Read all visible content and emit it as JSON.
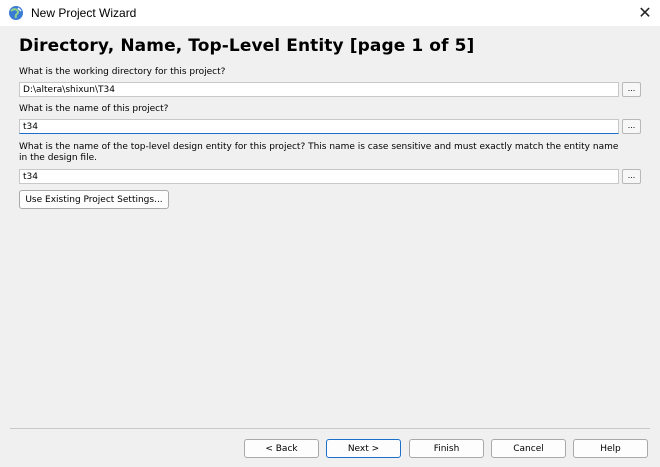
{
  "window": {
    "title": "New Project Wizard",
    "close_symbol": "✕"
  },
  "heading": "Directory, Name, Top-Level Entity [page 1 of 5]",
  "questions": {
    "directory_label": "What is the working directory for this project?",
    "directory_value": "D:\\altera\\shixun\\T34",
    "name_label": "What is the name of this project?",
    "name_value": "t34",
    "entity_label": "What is the name of the top-level design entity for this project? This name is case sensitive and must exactly match the entity name in the design file.",
    "entity_value": "t34"
  },
  "browse_label": "...",
  "buttons": {
    "use_existing": "Use Existing Project Settings...",
    "back": "< Back",
    "next": "Next >",
    "finish": "Finish",
    "cancel": "Cancel",
    "help": "Help"
  },
  "colors": {
    "accent": "#1a6fc9",
    "background": "#f0f0f0"
  },
  "icons": {
    "app": "wizard-globe-icon",
    "close": "close-icon"
  }
}
